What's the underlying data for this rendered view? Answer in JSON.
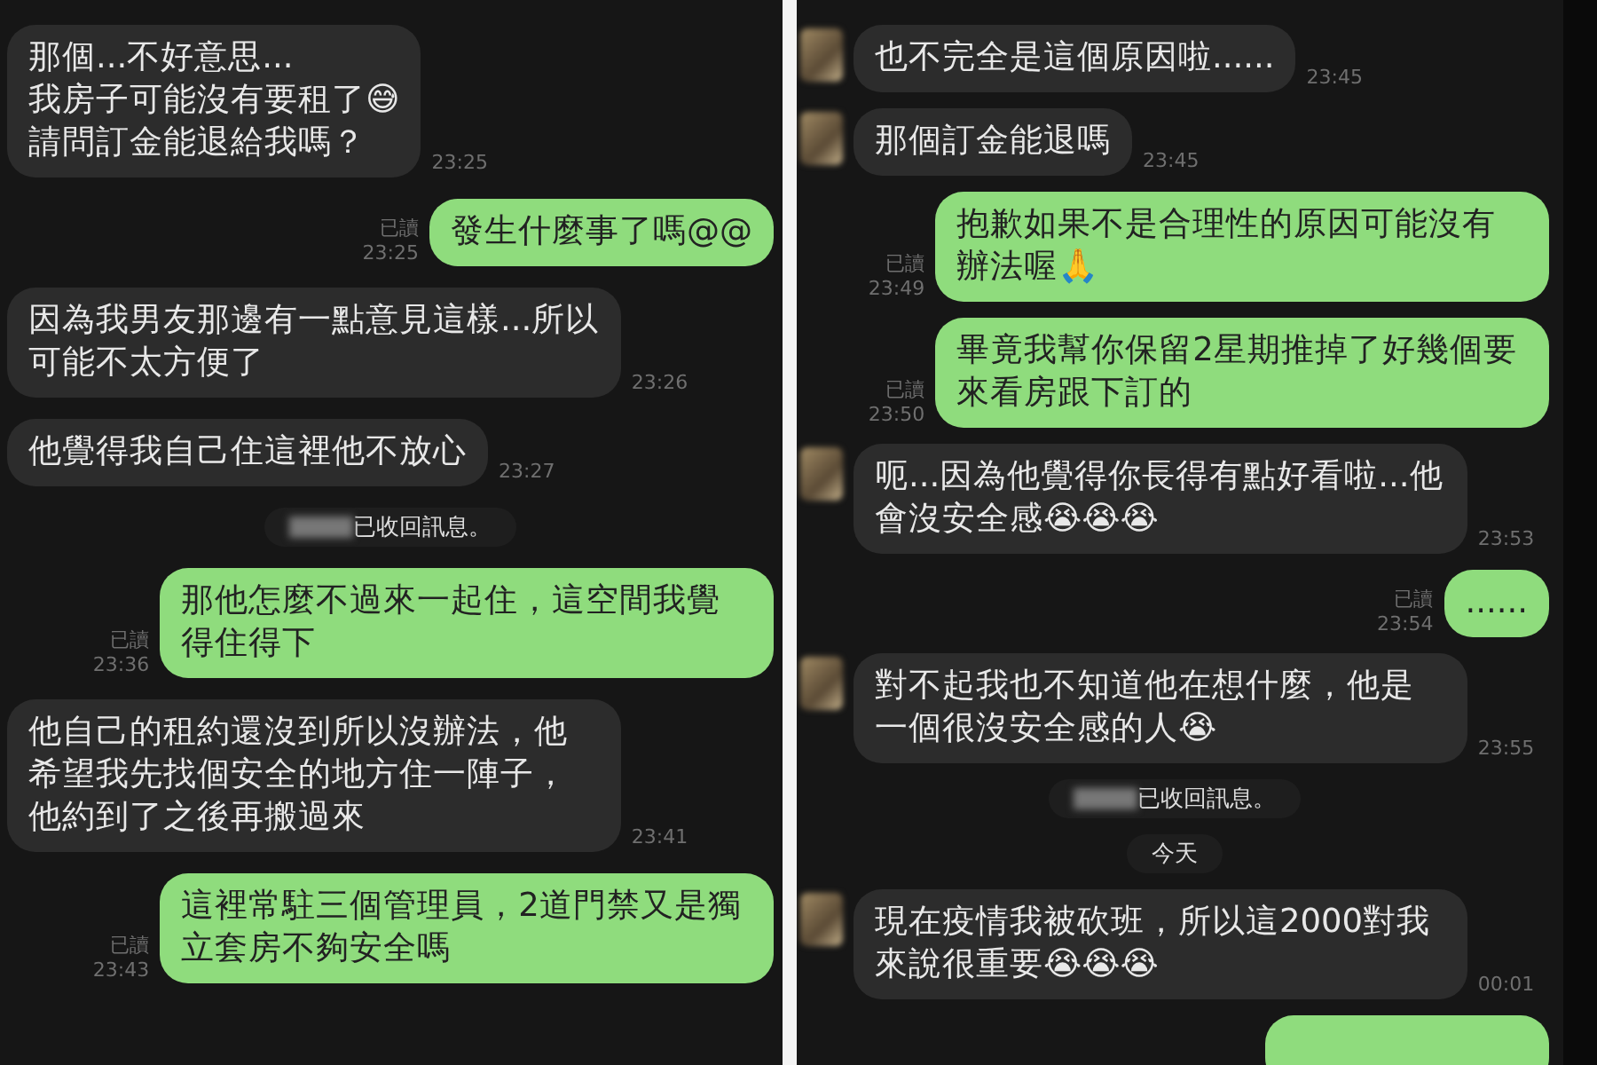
{
  "panels": [
    {
      "items": [
        {
          "kind": "received",
          "avatar": false,
          "text": "那個...不好意思...\n我房子可能沒有要租了😅\n請問訂金能退給我嗎？",
          "time": "23:25"
        },
        {
          "kind": "sent",
          "text": "發生什麼事了嗎@@",
          "read_label": "已讀",
          "time": "23:25"
        },
        {
          "kind": "received",
          "avatar": false,
          "text": "因為我男友那邊有一點意見這樣...所以可能不太方便了",
          "time": "23:26"
        },
        {
          "kind": "received",
          "avatar": false,
          "text": "他覺得我自己住這裡他不放心",
          "time": "23:27"
        },
        {
          "kind": "system",
          "text": "已收回訊息。"
        },
        {
          "kind": "sent",
          "text": "那他怎麼不過來一起住，這空間我覺得住得下",
          "read_label": "已讀",
          "time": "23:36"
        },
        {
          "kind": "received",
          "avatar": false,
          "text": "他自己的租約還沒到所以沒辦法，他希望我先找個安全的地方住一陣子，他約到了之後再搬過來",
          "time": "23:41"
        },
        {
          "kind": "sent",
          "text": "這裡常駐三個管理員，2道門禁又是獨立套房不夠安全嗎",
          "read_label": "已讀",
          "time": "23:43"
        }
      ]
    },
    {
      "items": [
        {
          "kind": "received",
          "avatar": true,
          "text": "也不完全是這個原因啦......",
          "time": "23:45"
        },
        {
          "kind": "received",
          "avatar": true,
          "text": "那個訂金能退嗎",
          "time": "23:45"
        },
        {
          "kind": "sent",
          "text": "抱歉如果不是合理性的原因可能沒有辦法喔🙏",
          "read_label": "已讀",
          "time": "23:49"
        },
        {
          "kind": "sent",
          "text": "畢竟我幫你保留2星期推掉了好幾個要來看房跟下訂的",
          "read_label": "已讀",
          "time": "23:50"
        },
        {
          "kind": "received",
          "avatar": true,
          "text": "呃...因為他覺得你長得有點好看啦...他會沒安全感😭😭😭",
          "time": "23:53"
        },
        {
          "kind": "sent",
          "text": "......",
          "read_label": "已讀",
          "time": "23:54"
        },
        {
          "kind": "received",
          "avatar": true,
          "text": "對不起我也不知道他在想什麼，他是一個很沒安全感的人😭",
          "time": "23:55"
        },
        {
          "kind": "system",
          "text": "已收回訊息。"
        },
        {
          "kind": "date",
          "text": "今天"
        },
        {
          "kind": "received",
          "avatar": true,
          "text": "現在疫情我被砍班，所以這2000對我來說很重要😭😭😭",
          "time": "00:01"
        },
        {
          "kind": "partial"
        }
      ]
    }
  ]
}
